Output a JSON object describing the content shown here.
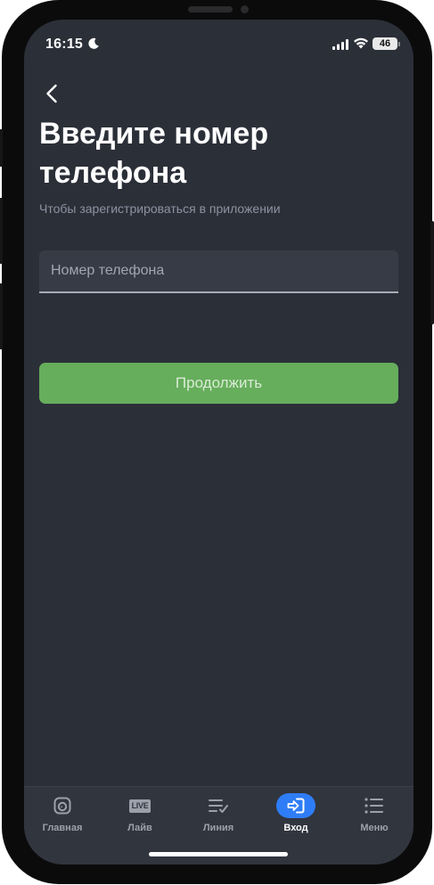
{
  "status_bar": {
    "time": "16:15",
    "battery": "46",
    "icons": [
      "moon-icon",
      "signal-icon",
      "wifi-icon",
      "battery-icon"
    ]
  },
  "header": {
    "back_icon": "chevron-left-icon",
    "title": "Введите номер телефона",
    "subtitle": "Чтобы зарегистрироваться в приложении"
  },
  "form": {
    "phone_placeholder": "Номер телефона",
    "phone_value": "",
    "continue_label": "Продолжить",
    "continue_color": "#66ad5c"
  },
  "tab_bar": {
    "active": "Вход",
    "accent_color": "#2f7df6",
    "tabs": [
      {
        "label": "Главная",
        "icon": "home-icon"
      },
      {
        "label": "Лайв",
        "icon": "live-icon",
        "icon_text": "LIVE"
      },
      {
        "label": "Линия",
        "icon": "line-list-icon"
      },
      {
        "label": "Вход",
        "icon": "login-icon"
      },
      {
        "label": "Меню",
        "icon": "menu-icon"
      }
    ]
  },
  "colors": {
    "screen_background": "#2b2f38",
    "subtitle": "#8c93a1"
  }
}
